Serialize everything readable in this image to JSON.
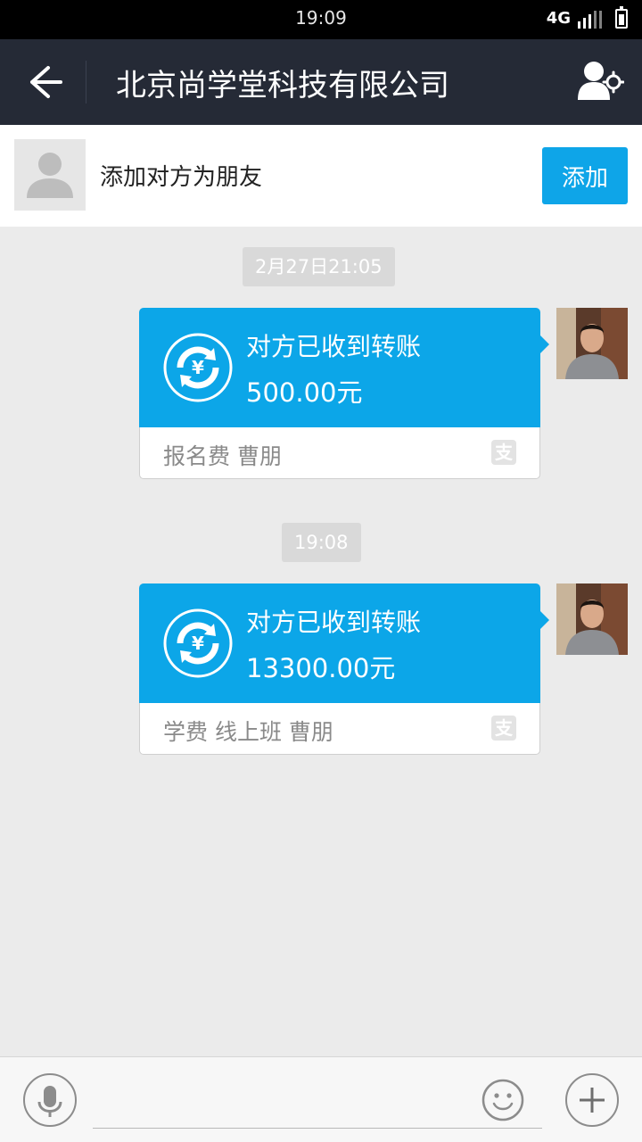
{
  "status_bar": {
    "time": "19:09",
    "network": "4G"
  },
  "header": {
    "title": "北京尚学堂科技有限公司"
  },
  "add_friend": {
    "prompt": "添加对方为朋友",
    "button_label": "添加"
  },
  "messages": [
    {
      "timestamp": "2月27日21:05",
      "status": "对方已收到转账",
      "amount": "500.00元",
      "note": "报名费  曹朋",
      "source_icon": "支"
    },
    {
      "timestamp": "19:08",
      "status": "对方已收到转账",
      "amount": "13300.00元",
      "note": "学费 线上班 曹朋",
      "source_icon": "支"
    }
  ],
  "colors": {
    "accent": "#0ca6e8",
    "header_bg": "#252a36",
    "chat_bg": "#ebebeb"
  }
}
